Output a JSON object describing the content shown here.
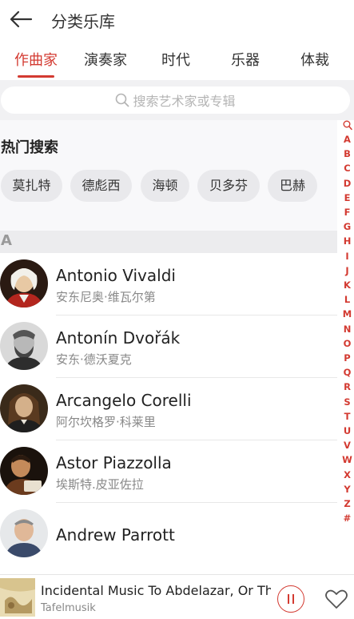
{
  "header": {
    "title": "分类乐库"
  },
  "tabs": [
    {
      "label": "作曲家",
      "active": true
    },
    {
      "label": "演奏家",
      "active": false
    },
    {
      "label": "时代",
      "active": false
    },
    {
      "label": "乐器",
      "active": false
    },
    {
      "label": "体裁",
      "active": false
    }
  ],
  "search": {
    "placeholder": "搜索艺术家或专辑"
  },
  "hot": {
    "title": "热门搜索",
    "chips": [
      "莫扎特",
      "德彪西",
      "海顿",
      "贝多芬",
      "巴赫"
    ]
  },
  "section": {
    "letter": "A"
  },
  "artists": [
    {
      "name": "Antonio Vivaldi",
      "subtitle": "安东尼奥·维瓦尔第"
    },
    {
      "name": "Antonín Dvořák",
      "subtitle": "安东·德沃夏克"
    },
    {
      "name": "Arcangelo Corelli",
      "subtitle": "阿尔坎格罗·科莱里"
    },
    {
      "name": "Astor Piazzolla",
      "subtitle": "埃斯特.皮亚佐拉"
    },
    {
      "name": "Andrew Parrott",
      "subtitle": ""
    }
  ],
  "index_letters": [
    "A",
    "B",
    "C",
    "D",
    "E",
    "F",
    "G",
    "H",
    "I",
    "J",
    "K",
    "L",
    "M",
    "N",
    "O",
    "P",
    "Q",
    "R",
    "S",
    "T",
    "U",
    "V",
    "W",
    "X",
    "Y",
    "Z",
    "#"
  ],
  "player": {
    "title": "Incidental Music To Abdelazar, Or The I",
    "artist": "Tafelmusik"
  },
  "colors": {
    "accent": "#d33a31",
    "chip_bg": "#e9e9ec",
    "band_bg": "#f1f1f3"
  }
}
